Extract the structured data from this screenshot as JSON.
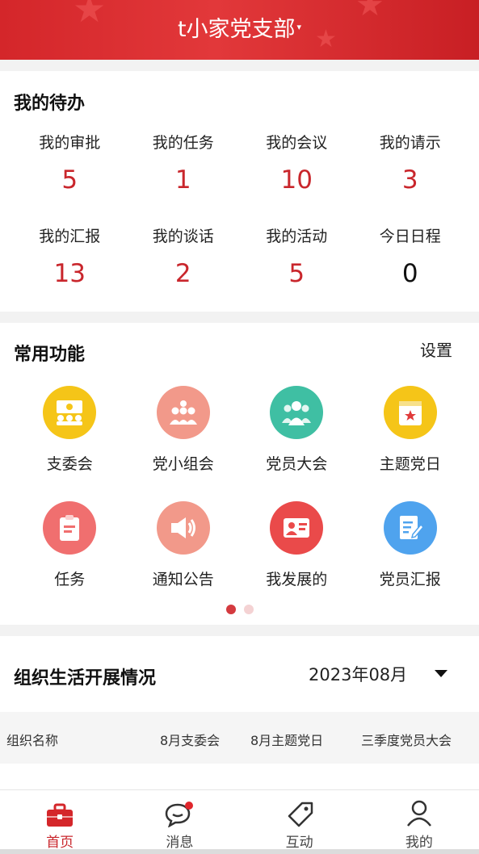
{
  "header": {
    "title": "t小家党支部",
    "caret": "▾"
  },
  "todo": {
    "title": "我的待办",
    "items": [
      {
        "label": "我的审批",
        "count": "5"
      },
      {
        "label": "我的任务",
        "count": "1"
      },
      {
        "label": "我的会议",
        "count": "10"
      },
      {
        "label": "我的请示",
        "count": "3"
      },
      {
        "label": "我的汇报",
        "count": "13"
      },
      {
        "label": "我的谈话",
        "count": "2"
      },
      {
        "label": "我的活动",
        "count": "5"
      },
      {
        "label": "今日日程",
        "count": "0"
      }
    ]
  },
  "functions": {
    "title": "常用功能",
    "settings_label": "设置",
    "items": [
      {
        "label": "支委会",
        "icon": "committee-meeting-icon",
        "color": "#f5c518"
      },
      {
        "label": "党小组会",
        "icon": "group-meeting-icon",
        "color": "#f2998a"
      },
      {
        "label": "党员大会",
        "icon": "member-assembly-icon",
        "color": "#3fbfa3"
      },
      {
        "label": "主题党日",
        "icon": "theme-day-icon",
        "color": "#f5c518"
      },
      {
        "label": "任务",
        "icon": "clipboard-icon",
        "color": "#f06f6f"
      },
      {
        "label": "通知公告",
        "icon": "speaker-icon",
        "color": "#f2998a"
      },
      {
        "label": "我发展的",
        "icon": "id-card-icon",
        "color": "#ea4a4a"
      },
      {
        "label": "党员汇报",
        "icon": "edit-document-icon",
        "color": "#4fa3ee"
      }
    ],
    "page_indicator": {
      "current": 1,
      "total": 2
    }
  },
  "org_life": {
    "title": "组织生活开展情况",
    "month": "2023年08月",
    "columns": [
      "组织名称",
      "8月支委会",
      "8月主题党日",
      "三季度党员大会"
    ]
  },
  "tabbar": {
    "items": [
      {
        "label": "首页",
        "icon": "briefcase-icon",
        "active": true
      },
      {
        "label": "消息",
        "icon": "chat-bubble-icon",
        "active": false
      },
      {
        "label": "互动",
        "icon": "tag-icon",
        "active": false
      },
      {
        "label": "我的",
        "icon": "user-icon",
        "active": false
      }
    ]
  },
  "colors": {
    "primary": "#d4262a",
    "accent_text": "#c9262c"
  }
}
